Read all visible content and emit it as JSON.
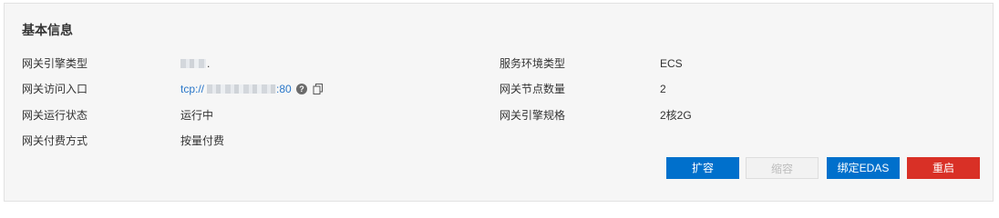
{
  "section": {
    "title": "基本信息"
  },
  "left_fields": [
    {
      "label": "网关引擎类型",
      "value": "."
    },
    {
      "label": "网关访问入口",
      "value_prefix": "tcp://",
      "value_suffix": ":80"
    },
    {
      "label": "网关运行状态",
      "value": "运行中"
    },
    {
      "label": "网关付费方式",
      "value": "按量付费"
    }
  ],
  "right_fields": [
    {
      "label": "服务环境类型",
      "value": "ECS"
    },
    {
      "label": "网关节点数量",
      "value": "2"
    },
    {
      "label": "网关引擎规格",
      "value": "2核2G"
    }
  ],
  "icons": {
    "help": "help-icon",
    "copy": "copy-icon",
    "help_glyph": "?"
  },
  "actions": {
    "expand": "扩容",
    "shrink": "缩容",
    "bind_edas": "绑定EDAS",
    "restart": "重启"
  },
  "colors": {
    "primary": "#0070cc",
    "danger": "#d93026",
    "link": "#2a77c9"
  }
}
